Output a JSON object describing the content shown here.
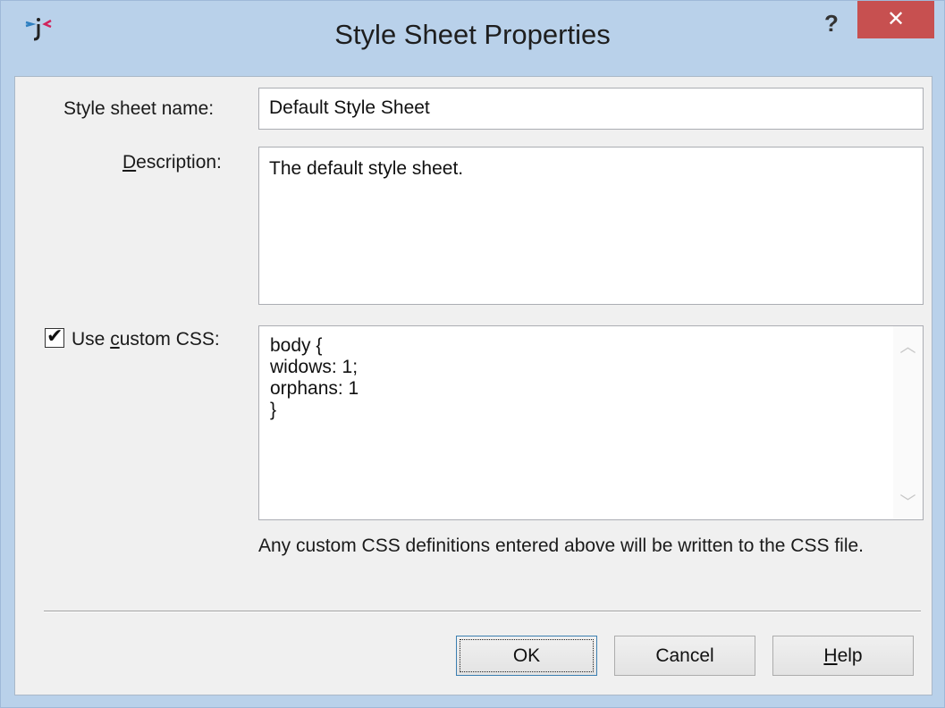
{
  "window": {
    "title": "Style Sheet Properties",
    "help_glyph": "?",
    "close_glyph": "✕"
  },
  "form": {
    "name_label": "Style sheet name:",
    "name_value": "Default Style Sheet",
    "description_label": "Description:",
    "description_value": "The default style sheet.",
    "custom_css_label": "Use custom CSS:",
    "custom_css_checked": true,
    "css_lines": [
      "body {",
      "widows: 1;",
      "orphans: 1",
      "}"
    ],
    "hint": "Any custom CSS definitions entered above will be written to the CSS file."
  },
  "buttons": {
    "ok": "OK",
    "cancel": "Cancel",
    "help": "Help"
  },
  "icons": [
    "app-logo-icon",
    "help-icon",
    "close-icon",
    "check-icon",
    "scroll-up-arrow-icon",
    "scroll-down-arrow-icon"
  ],
  "colors": {
    "titlebar": "#b9d1ea",
    "close_button": "#c75050",
    "dialog_bg": "#f0f0f0"
  }
}
